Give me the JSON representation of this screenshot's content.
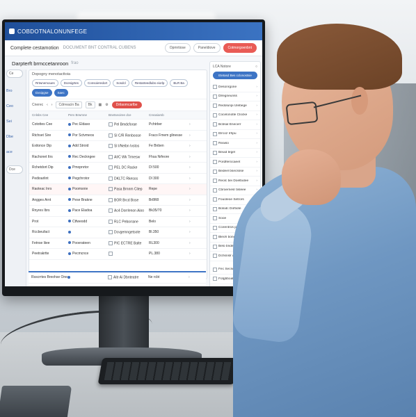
{
  "screen": {
    "app_title": "COBDOTNALONUNFEGE",
    "subheader": {
      "title": "Complete cestamotion",
      "muted": "DOCUMENT BNT CONTRAL CUBENS"
    },
    "header_buttons": [
      "Opmrtiose",
      "Paneldiove",
      "Cotmorgoenbnt"
    ],
    "page_title": "Darpterft brmccetanroon",
    "page_title_faded": "frao",
    "section_label": "Dopogny menotacttoia",
    "chips": [
      "Rrtwnemoues",
      "Dcesigrtes",
      "Consoieredort",
      "Sosdcl",
      "Restarteedlubs eiorlp",
      "BLR Ba",
      "Dxsipgse",
      "Saec"
    ],
    "toolbar": {
      "left": "Cnerec",
      "box1": "Cdrreacin Ba",
      "box2": "Bk",
      "red_button": "Drilaomcarlbe"
    },
    "table_header": [
      "Cnlsbs Cee",
      "Perv Brwmne",
      "Bnetseoiree dce",
      "Creasiarsb"
    ],
    "rows": [
      [
        "Cotottes Cee",
        "Pec Eldaso",
        "Pel Bmdcforae",
        "Pchtrber"
      ],
      [
        "Rtchset Sire",
        "Por Sctvmeos",
        "Sl C/R Renboose",
        "Fraco Fmem glinesse"
      ],
      [
        "Exitonce Dip",
        "Add Stroid",
        "Sl I/Neibn Ivstos",
        "Fe Bnben"
      ],
      [
        "Rachonet Itrs",
        "Rec Deckngee",
        "AI/C Wk Trmesw",
        "Fhsa Nrfeore"
      ],
      [
        "Rchetdort Dip",
        "Pmopnrtor",
        "PEL DC Racke",
        "Dl 500"
      ],
      [
        "Pedioarlint",
        "Pegchrotor",
        "DKLTC Rkesos",
        "Dl 300"
      ],
      [
        "Raoteac Inrs",
        "Poomsnie",
        "Pasa Brnnm Citep",
        "Repe"
      ],
      [
        "Angges Arnt",
        "Pese Brakne",
        "BOR Brcd Bose",
        "Br8R8"
      ],
      [
        "Rnyres Ibrs",
        "Pace Eladoa",
        "Ac4 Dorrlenon Aioo",
        "Bk35/70"
      ],
      [
        "Prot",
        "Ctfweodd",
        "RLC Peborrane",
        "Belo"
      ],
      [
        "Rccbeufact",
        "",
        "Dcvgemngetsote",
        "Bl.350"
      ],
      [
        "Fetnse liiee",
        "Pooerateen",
        "PIC ECTRE Balte",
        "RL300"
      ],
      [
        "Peetrakrtte",
        "Pecmcnce",
        "",
        "PL.380"
      ]
    ],
    "lower_rows": [
      [
        "Rsscrrtes Breohse Onesbre",
        "",
        "Aitr Ai Dbnteatre",
        "Ne rcbt"
      ],
      [
        "Ceoneesnne",
        "Der Baorre",
        "A2/IC Stnes",
        "Ecsne"
      ],
      [
        "Feoset Stlos",
        "Petbiote",
        "PLC Cohaloe",
        "Erao"
      ]
    ],
    "left_edge": [
      "Ce",
      "Bro",
      "Ceo",
      "Sei",
      "Dbe",
      "ace",
      "Dce"
    ],
    "right_panel": {
      "title": "LCA Notore",
      "button": "Etetasd Bes cclonostsie",
      "items": [
        "Desonrgone",
        "Dlregneunss",
        "Redolunpi Ulebege",
        "Cocelonotle Clocke",
        "Bcbsal Enecerr",
        "Elrcoz Irhpu",
        "Reaiso",
        "Beuid tegel",
        "Pordflerocaeet",
        "Bedeel bsecssse",
        "Reolc bei Doelbutee",
        "Cbroernesr bsleee",
        "Fouoleoe Setrors",
        "Bolodc Doftiote",
        "Sooe",
        "Cceentros pshsscee",
        "Bleoh bonedore",
        "Belo bndesie",
        "Dchsnslr dlle"
      ],
      "footer_items": [
        "Fec Secsee",
        "Fotgbboate",
        "Terpteurs"
      ]
    }
  }
}
